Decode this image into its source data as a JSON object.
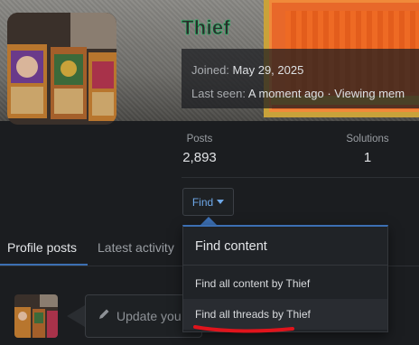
{
  "profile": {
    "username": "Thief",
    "joined_label": "Joined:",
    "joined_value": "May 29, 2025",
    "last_seen_label": "Last seen:",
    "last_seen_value": "A moment ago · Viewing mem"
  },
  "stats": {
    "posts_label": "Posts",
    "posts_value": "2,893",
    "solutions_label": "Solutions",
    "solutions_value": "1"
  },
  "find_button": {
    "label": "Find",
    "icon": "caret-down-icon"
  },
  "tabs": [
    {
      "label": "Profile posts",
      "active": true
    },
    {
      "label": "Latest activity",
      "active": false
    }
  ],
  "composer": {
    "placeholder": "Update you",
    "icon": "pencil-icon"
  },
  "dropdown": {
    "header": "Find content",
    "items": [
      {
        "label": "Find all content by Thief"
      },
      {
        "label": "Find all threads by Thief"
      }
    ]
  },
  "colors": {
    "accent": "#3c6fb3",
    "link": "#6ea8e8",
    "username_outline": "#22c86a",
    "annotation": "#e0141c"
  }
}
